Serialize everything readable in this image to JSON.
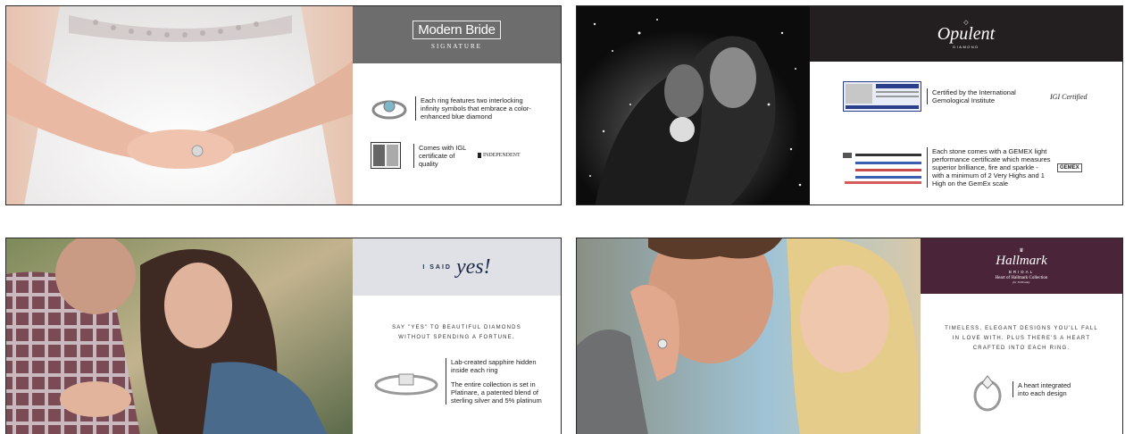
{
  "modern_bride": {
    "logo": "Modern Bride",
    "sub": "SIGNATURE",
    "row1_text": "Each ring features two interlocking infinity symbols that embrace a color-enhanced blue diamond",
    "row2_text": "Comes with IGL certificate of quality",
    "igl_logo": "INDEPENDENT"
  },
  "opulent": {
    "logo": "Opulent",
    "sub": "DIAMOND",
    "row1_text": "Certified by the International Gemological Institute",
    "igi_logo": "IGI Certified",
    "row2_text": "Each stone comes with a GEMEX light performance certificate which measures superior brilliance, fire and sparkle - with a minimum of 2 Very Highs and 1 High on the GemEx scale",
    "gemex_logo": "GEMEX"
  },
  "i_said_yes": {
    "logo_small": "I SAID",
    "logo_script": "yes!",
    "tagline": "SAY \"YES\" TO BEAUTIFUL DIAMONDS WITHOUT SPENDING A FORTUNE.",
    "row_text_1": "Lab-created sapphire hidden inside each ring",
    "row_text_2": "The entire collection is set in Platinare, a patented blend of sterling silver and 5% platinum"
  },
  "hallmark": {
    "logo": "Hallmark",
    "sub1": "BRIDAL",
    "sub2": "Heart of Hallmark Collection",
    "sub3": "for JCPenney",
    "tagline": "TIMELESS, ELEGANT DESIGNS YOU'LL FALL IN LOVE WITH. PLUS THERE'S A HEART CRAFTED INTO EACH RING.",
    "row_text": "A heart integrated into each design"
  },
  "colors": {
    "mb_band": "#6d6d6d",
    "op_band": "#231f20",
    "isy_band": "#dfe1e6",
    "hm_band": "#4a2438",
    "isy_script": "#1c2b4a"
  }
}
